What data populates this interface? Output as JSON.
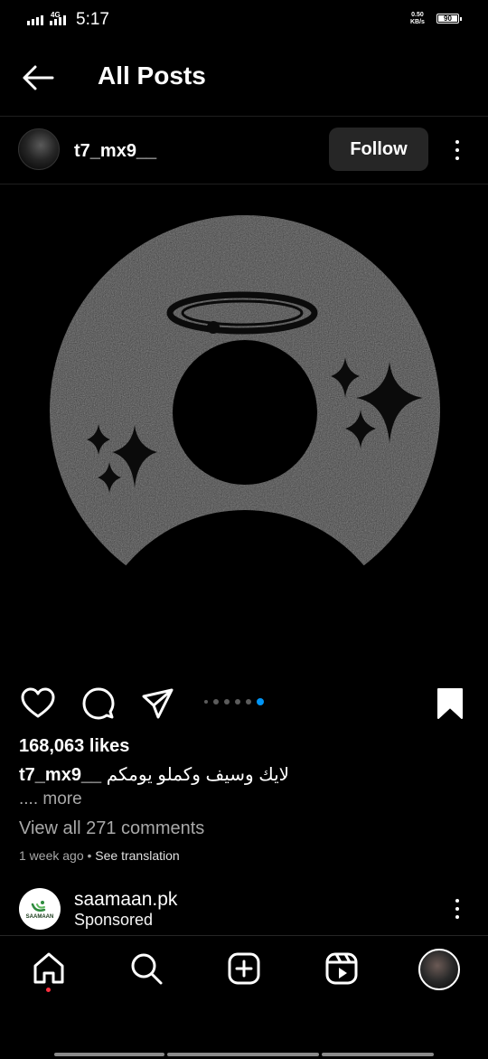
{
  "status_bar": {
    "network": "4G",
    "time": "5:17",
    "speed_value": "0.50",
    "speed_unit": "KB/s",
    "battery": "90"
  },
  "header": {
    "title": "All Posts",
    "back_icon": "arrow-left-icon"
  },
  "post": {
    "username": "t7_mx9__",
    "follow_label": "Follow",
    "likes": "168,063 likes",
    "caption_user": "t7_mx9__",
    "caption_text": "لايك وسيف وكملو يومكم",
    "more_label": ".... more",
    "comments_label": "View all 271 comments",
    "time_ago": "1 week ago",
    "separator": " • ",
    "see_translation": "See translation",
    "carousel": {
      "count": 6,
      "active_index": 5
    },
    "icons": [
      "heart-icon",
      "comment-icon",
      "share-icon",
      "bookmark-icon"
    ]
  },
  "sponsored": {
    "name": "saamaan.pk",
    "label": "Sponsored",
    "logo_text": "SAAMAAN"
  },
  "bottom_nav": {
    "items": [
      "home-icon",
      "search-icon",
      "create-icon",
      "reels-icon",
      "profile-avatar"
    ]
  },
  "colors": {
    "background": "#000000",
    "accent_blue": "#0095f6",
    "secondary_text": "#a8a8a8",
    "button_bg": "#262626",
    "notification_dot": "#ff3040"
  }
}
